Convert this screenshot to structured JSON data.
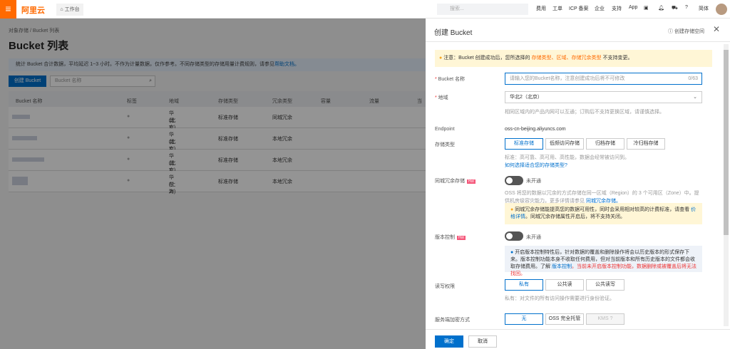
{
  "topbar": {
    "menu_icon": "hamburger-icon",
    "logo": "阿里云",
    "workspace": "工作台",
    "search_placeholder": "搜索...",
    "nav": [
      "费用",
      "工单",
      "ICP 备案",
      "企业",
      "支持",
      "App"
    ],
    "lang": "简体"
  },
  "main": {
    "breadcrumb": [
      "对象存储",
      "Bucket 列表"
    ],
    "title": "Bucket 列表",
    "info": "统计 Bucket 合计数据，平均延迟 1~3 小时。不作为计量数据，仅作参考。不同存储类型的存储用量计费规则，请参见",
    "info_link": "帮助文档。",
    "create_btn": "创建 Bucket",
    "search_placeholder": "Bucket 名称",
    "columns": [
      "Bucket 名称",
      "标签",
      "地域",
      "存储类型",
      "冗余类型",
      "容量",
      "流量",
      "当"
    ],
    "rows": [
      {
        "region": "华北2",
        "city": "(北京)",
        "storage": "标准存储",
        "redundancy": "同城冗余"
      },
      {
        "region": "华北2",
        "city": "(北京)",
        "storage": "标准存储",
        "redundancy": "本地冗余"
      },
      {
        "region": "华北2",
        "city": "(北京)",
        "storage": "标准存储",
        "redundancy": "本地冗余"
      },
      {
        "region": "华东2",
        "city": "(上海)",
        "storage": "标准存储",
        "redundancy": "本地冗余"
      }
    ]
  },
  "panel": {
    "title": "创建 Bucket",
    "help": "创建存储空间",
    "notice_pre": "注意：Bucket 创建成功后，您所选择的",
    "notice_hl": "存储类型、区域、存储冗余类型",
    "notice_post": "不支持变更。",
    "name_label": "Bucket 名称",
    "name_placeholder": "请输入您的Bucket名称，注意创建成功后将不可修改",
    "name_count": "0/63",
    "region_label": "地域",
    "region_value": "华北2（北京）",
    "region_hint": "相同区域内的产品内网可以互通；订购后不支持更换区域，请谨慎选择。",
    "endpoint_label": "Endpoint",
    "endpoint_value": "oss-cn-beijing.aliyuncs.com",
    "storage_label": "存储类型",
    "storage_options": [
      "标准存储",
      "低频访问存储",
      "归档存储",
      "冷归档存储"
    ],
    "storage_hint": "标准：高可靠、高可用、高性能，数据会经常被访问到。",
    "storage_link": "如何选择适合您的存储类型?",
    "zrs_label": "同城冗余存储",
    "hot": "Hot",
    "zrs_state": "未开通",
    "zrs_desc": "OSS 将您的数据以冗余的方式存储在同一区域（Region）的 3 个可用区（Zone）中。提供机房级容灾能力。更多详情请参见",
    "zrs_link": "同城冗余存储。",
    "zrs_warn": "同城冗余存储能提高您的数据可用性，同时会采用相对较高的计费标准，请查看",
    "zrs_warn_link": "价格详情",
    "zrs_warn_post": "。同城冗余存储属性开启后，将不支持关闭。",
    "ver_label": "版本控制",
    "ver_state": "未开通",
    "ver_info": "开启版本控制特性后，针对数据的覆盖和删除操作将会以历史版本的形式保存下来。版本控制功能本身不收取任何费用，但对当前版本和所有历史版本的文件都会收取存储费用。了解",
    "ver_link": "版本控制",
    "ver_warn": "。当前未开启版本控制功能，数据删除或被覆盖后将无法找回。",
    "acl_label": "读写权限",
    "acl_options": [
      "私有",
      "公共读",
      "公共读写"
    ],
    "acl_hint": "私有：对文件的所有访问操作需要进行身份验证。",
    "enc_label": "服务端加密方式",
    "enc_options": [
      "无",
      "OSS 完全托管",
      "KMS"
    ],
    "ok": "确定",
    "cancel": "取消"
  }
}
